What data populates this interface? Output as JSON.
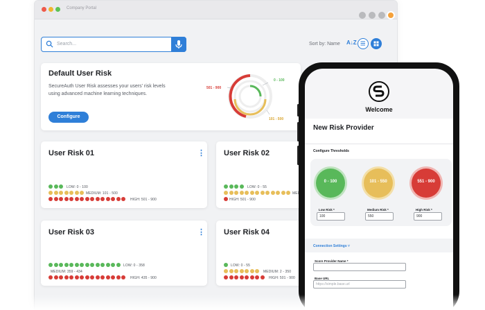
{
  "window": {
    "title": "Company Portal"
  },
  "toolbar": {
    "search_placeholder": "Search...",
    "sort_label": "Sort by: Name",
    "sort_icon": "A↓Z"
  },
  "default_card": {
    "title": "Default User Risk",
    "description_line1": "SecureAuth User Risk assesses your users' risk levels",
    "description_line2": "using advanced machine learning techniques.",
    "button": "Configure",
    "gauge_labels": {
      "low": "0 - 100",
      "medium": "101 - 500",
      "high": "501 - 900"
    }
  },
  "risk_cards": [
    {
      "title": "User Risk 01",
      "low": "LOW: 0 - 100",
      "medium": "MEDIUM: 101 - 500",
      "high": "HIGH: 501 - 900"
    },
    {
      "title": "User Risk 02",
      "low": "LOW: 0 - 55",
      "medium": "MEDI",
      "high": "HIGH: 501 - 900"
    },
    {
      "title": "User Risk 03",
      "low": "LOW: 0 - 358",
      "medium": "MEDIUM: 359 - 434",
      "high": "HIGH: 435 - 900"
    },
    {
      "title": "User Risk 04",
      "low": "LOW: 0 - 55",
      "medium": "MEDIUM: 2 - 350",
      "high": "HIGH: 501 - 900"
    }
  ],
  "phone": {
    "welcome": "Welcome",
    "title": "New Risk Provider",
    "thresholds_heading": "Configure Thresholds",
    "circles": [
      "0 - 100",
      "101 - 550",
      "551 - 900"
    ],
    "low_label": "Low Risk *",
    "medium_label": "Medium Risk *",
    "high_label": "High Risk *",
    "low_value": "100",
    "medium_value": "550",
    "high_value": "900",
    "connection_settings": "Connection Settings ˅",
    "provider_name_label": "Score Provider Name *",
    "base_url_label": "Base URL",
    "base_url_placeholder": "https://simple.base.url"
  },
  "colors": {
    "accent": "#2f7fd8",
    "low": "#59b85a",
    "medium": "#e7be5a",
    "high": "#d73c37"
  }
}
